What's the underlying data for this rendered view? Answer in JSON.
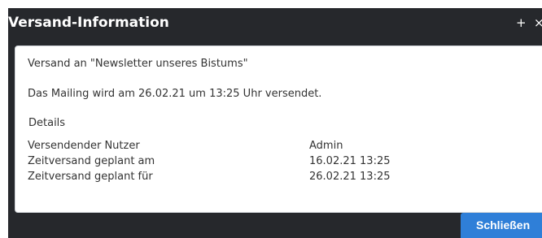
{
  "dialog": {
    "title": "Versand-Information",
    "maximize_label": "+",
    "close_label": "×"
  },
  "content": {
    "subject_line": "Versand an \"Newsletter unseres Bistums\"",
    "schedule_line": "Das Mailing wird am 26.02.21 um 13:25 Uhr versendet.",
    "details_heading": "Details",
    "rows": [
      {
        "label": "Versendender Nutzer",
        "value": "Admin"
      },
      {
        "label": "Zeitversand geplant am",
        "value": "16.02.21 13:25"
      },
      {
        "label": "Zeitversand geplant für",
        "value": "26.02.21 13:25"
      }
    ]
  },
  "footer": {
    "close_button": "Schließen"
  },
  "colors": {
    "dialog_bg": "#26282c",
    "button_bg": "#2f7fd8"
  }
}
